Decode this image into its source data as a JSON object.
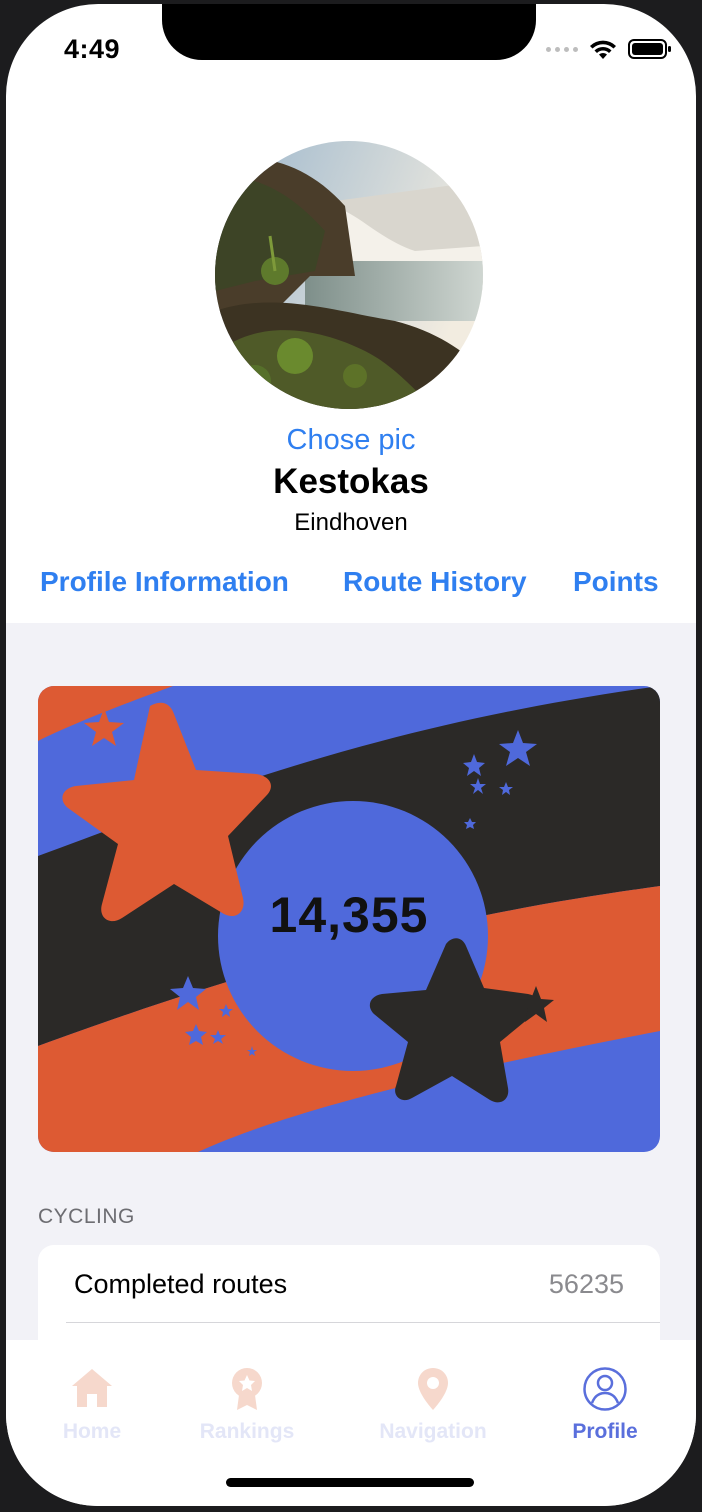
{
  "status_bar": {
    "time": "4:49"
  },
  "profile": {
    "choose_pic_label": "Chose pic",
    "name": "Kestokas",
    "city": "Eindhoven"
  },
  "tabs": [
    {
      "label": "Profile Information"
    },
    {
      "label": "Route History"
    },
    {
      "label": "Points"
    }
  ],
  "points_card": {
    "value": "14,355"
  },
  "cycling": {
    "header": "CYCLING",
    "rows": [
      {
        "label": "Completed routes",
        "value": "56235"
      }
    ]
  },
  "tab_bar": {
    "items": [
      {
        "label": "Home",
        "icon": "home-icon"
      },
      {
        "label": "Rankings",
        "icon": "badge-icon"
      },
      {
        "label": "Navigation",
        "icon": "map-pin-icon"
      },
      {
        "label": "Profile",
        "icon": "person-circle-icon"
      }
    ]
  },
  "colors": {
    "accent_blue": "#2f7ff0",
    "card_orange": "#dd5a33",
    "card_blue": "#4f69db",
    "card_dark": "#2b2927",
    "tab_active": "#5a6fdc",
    "tab_inactive": "#e3e6f7"
  }
}
